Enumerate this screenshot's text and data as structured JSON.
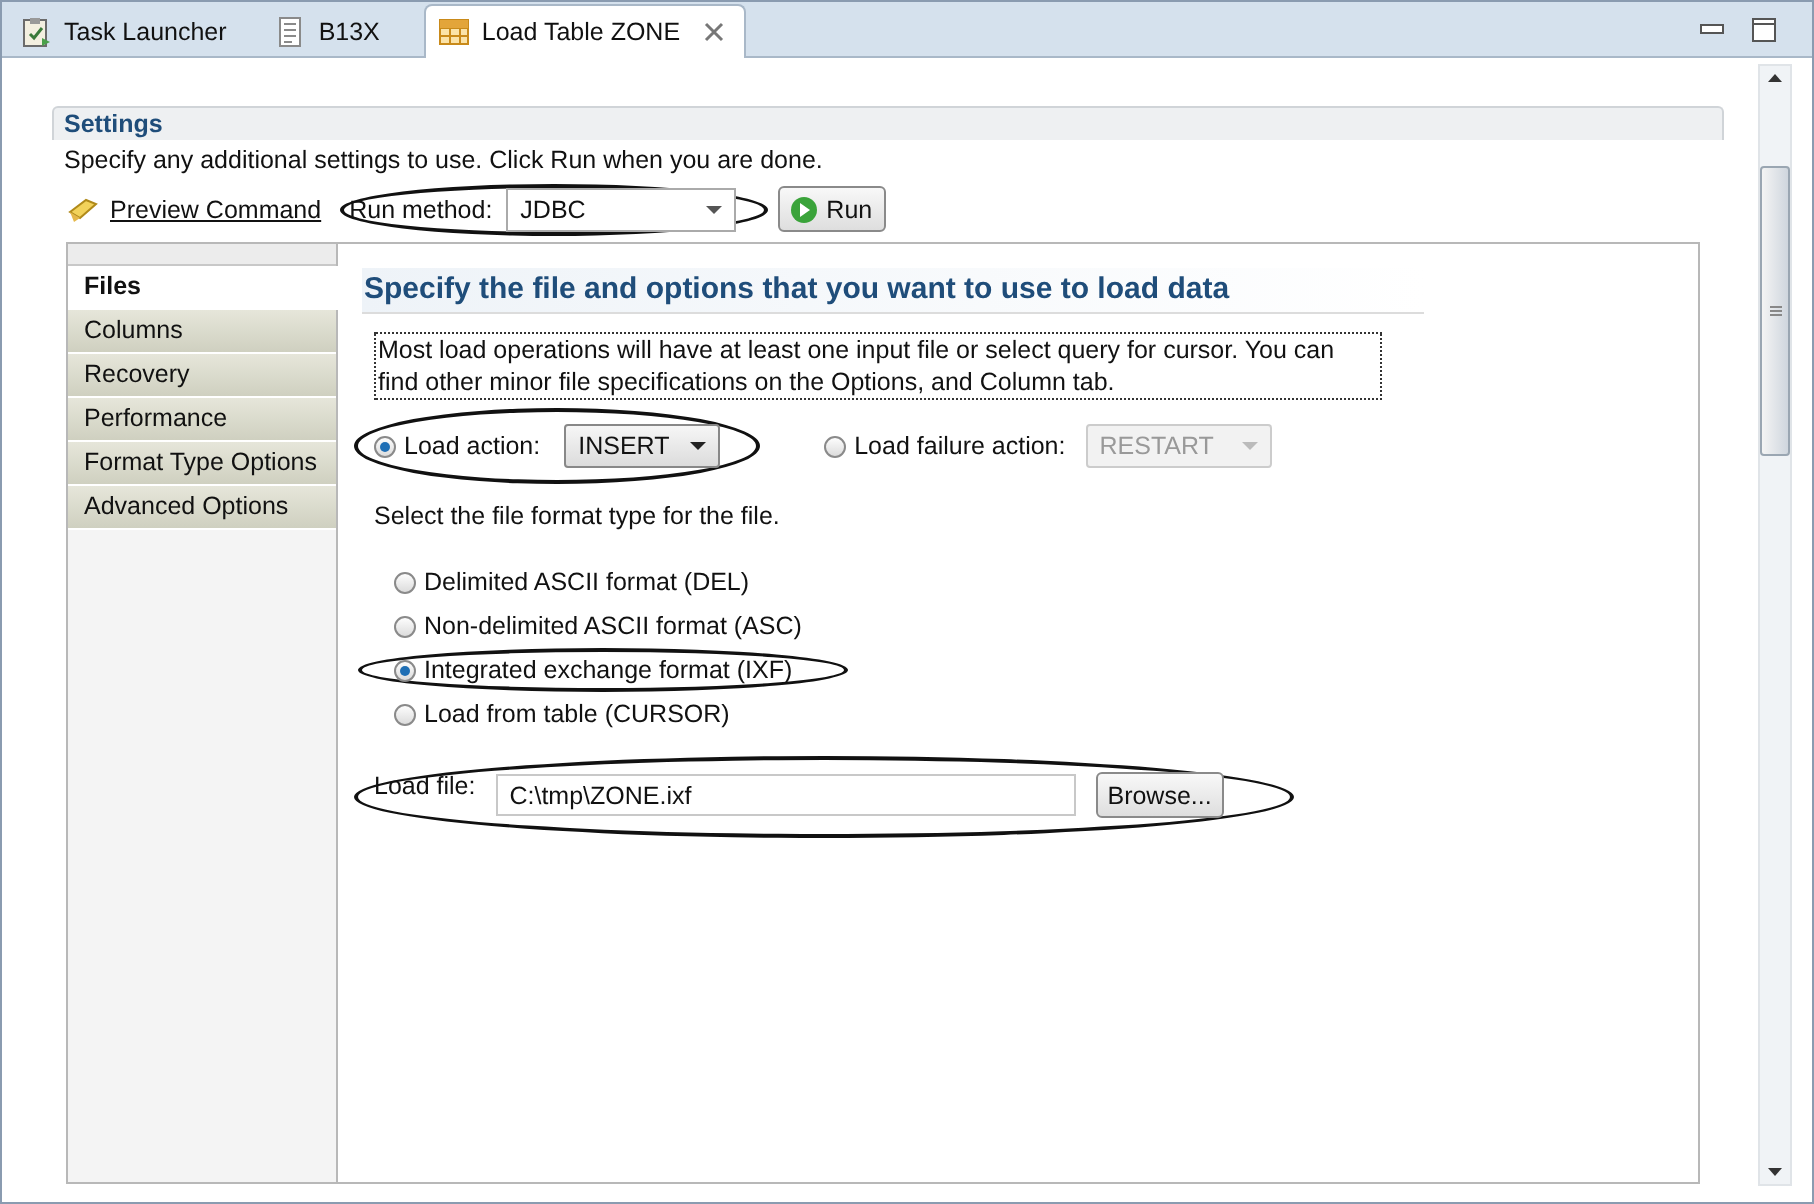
{
  "tabs": [
    {
      "label": "Task Launcher",
      "kind": "launcher",
      "selected": false,
      "closable": false
    },
    {
      "label": "B13X",
      "kind": "list",
      "selected": false,
      "closable": false
    },
    {
      "label": "Load Table ZONE",
      "kind": "table",
      "selected": true,
      "closable": true
    }
  ],
  "settings": {
    "title": "Settings",
    "description": "Specify any additional settings to use. Click Run when you are done.",
    "preview_link": "Preview Command",
    "run_method": {
      "label": "Run method:",
      "value": "JDBC",
      "highlighted": true
    },
    "run_button": "Run"
  },
  "nav": [
    {
      "label": "Files",
      "selected": true
    },
    {
      "label": "Columns",
      "selected": false
    },
    {
      "label": "Recovery",
      "selected": false
    },
    {
      "label": "Performance",
      "selected": false
    },
    {
      "label": "Format Type Options",
      "selected": false
    },
    {
      "label": "Advanced Options",
      "selected": false
    }
  ],
  "heading": "Specify the file and options that you want to use to load data",
  "info": "Most load operations will have at least one input file or select query for cursor. You can find other minor file specifications on the Options, and Column tab.",
  "load_action": {
    "label": "Load action:",
    "value": "INSERT",
    "selected": true,
    "highlighted": true
  },
  "load_failure_action": {
    "label": "Load failure action:",
    "value": "RESTART",
    "selected": false,
    "disabled": true
  },
  "format_prompt": "Select the file format type for the file.",
  "formats": [
    {
      "label": "Delimited ASCII format (DEL)",
      "selected": false,
      "highlighted": false
    },
    {
      "label": "Non-delimited ASCII format (ASC)",
      "selected": false,
      "highlighted": false
    },
    {
      "label": "Integrated exchange format (IXF)",
      "selected": true,
      "highlighted": true
    },
    {
      "label": "Load from table (CURSOR)",
      "selected": false,
      "highlighted": false
    }
  ],
  "load_file": {
    "label": "Load file:",
    "value": "C:\\tmp\\ZONE.ixf",
    "highlighted": true
  },
  "browse_button": "Browse..."
}
